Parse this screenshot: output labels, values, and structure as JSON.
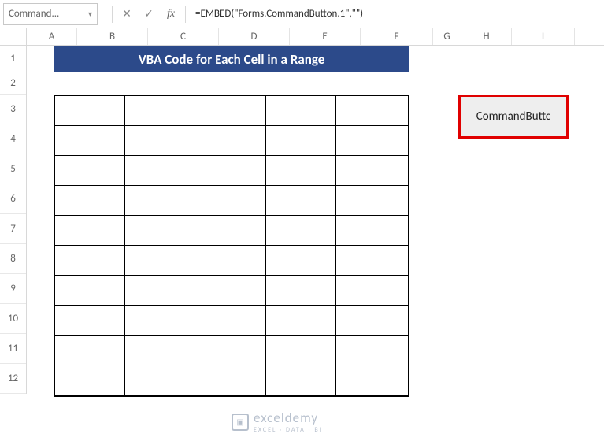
{
  "name_box": {
    "value": "Command..."
  },
  "formula": "=EMBED(\"Forms.CommandButton.1\",\"\")",
  "fx_label": "fx",
  "columns": [
    {
      "label": "A",
      "width": 64
    },
    {
      "label": "B",
      "width": 90
    },
    {
      "label": "C",
      "width": 90
    },
    {
      "label": "D",
      "width": 90
    },
    {
      "label": "E",
      "width": 90
    },
    {
      "label": "F",
      "width": 92
    },
    {
      "label": "G",
      "width": 36
    },
    {
      "label": "H",
      "width": 64
    },
    {
      "label": "I",
      "width": 80
    }
  ],
  "rows": [
    {
      "label": "1",
      "height": 34
    },
    {
      "label": "2",
      "height": 28
    },
    {
      "label": "3",
      "height": 38
    },
    {
      "label": "4",
      "height": 38
    },
    {
      "label": "5",
      "height": 38
    },
    {
      "label": "6",
      "height": 38
    },
    {
      "label": "7",
      "height": 38
    },
    {
      "label": "8",
      "height": 38
    },
    {
      "label": "9",
      "height": 38
    },
    {
      "label": "10",
      "height": 38
    },
    {
      "label": "11",
      "height": 38
    },
    {
      "label": "12",
      "height": 38
    }
  ],
  "title_banner": "VBA Code for Each Cell in a Range",
  "table": {
    "rows": 10,
    "cols": 5
  },
  "col_widths_table": [
    90,
    90,
    90,
    90,
    92
  ],
  "command_button": {
    "label": "CommandButtc"
  },
  "watermark": {
    "main": "exceldemy",
    "sub": "EXCEL · DATA · BI",
    "icon": "▣"
  }
}
